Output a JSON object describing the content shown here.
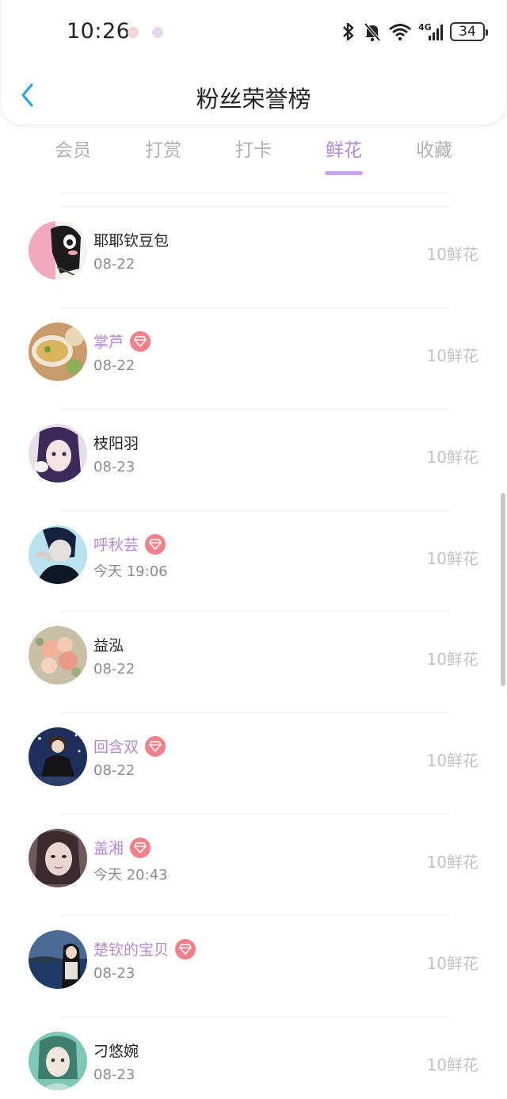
{
  "status_bar": {
    "time": "10:26",
    "network": "4G",
    "battery": "34"
  },
  "nav": {
    "title": "粉丝荣誉榜"
  },
  "tabs": [
    {
      "label": "会员",
      "active": false
    },
    {
      "label": "打赏",
      "active": false
    },
    {
      "label": "打卡",
      "active": false
    },
    {
      "label": "鲜花",
      "active": true
    },
    {
      "label": "收藏",
      "active": false
    }
  ],
  "colors": {
    "accent": "#b488d8",
    "badge": "#f28088",
    "back_arrow": "#2fa3e6"
  },
  "fans": [
    {
      "name": "耶耶钦豆包",
      "date": "08-22",
      "flowers": "10鲜花",
      "vip": false
    },
    {
      "name": "掌芦",
      "date": "08-22",
      "flowers": "10鲜花",
      "vip": true
    },
    {
      "name": "枝阳羽",
      "date": "08-23",
      "flowers": "10鲜花",
      "vip": false
    },
    {
      "name": "呼秋芸",
      "date": "今天 19:06",
      "flowers": "10鲜花",
      "vip": true
    },
    {
      "name": "益泓",
      "date": "08-22",
      "flowers": "10鲜花",
      "vip": false
    },
    {
      "name": "回含双",
      "date": "08-22",
      "flowers": "10鲜花",
      "vip": true
    },
    {
      "name": "盖湘",
      "date": "今天 20:43",
      "flowers": "10鲜花",
      "vip": true
    },
    {
      "name": "楚钦的宝贝",
      "date": "08-23",
      "flowers": "10鲜花",
      "vip": true
    },
    {
      "name": "刁悠婉",
      "date": "08-23",
      "flowers": "10鲜花",
      "vip": false
    }
  ]
}
